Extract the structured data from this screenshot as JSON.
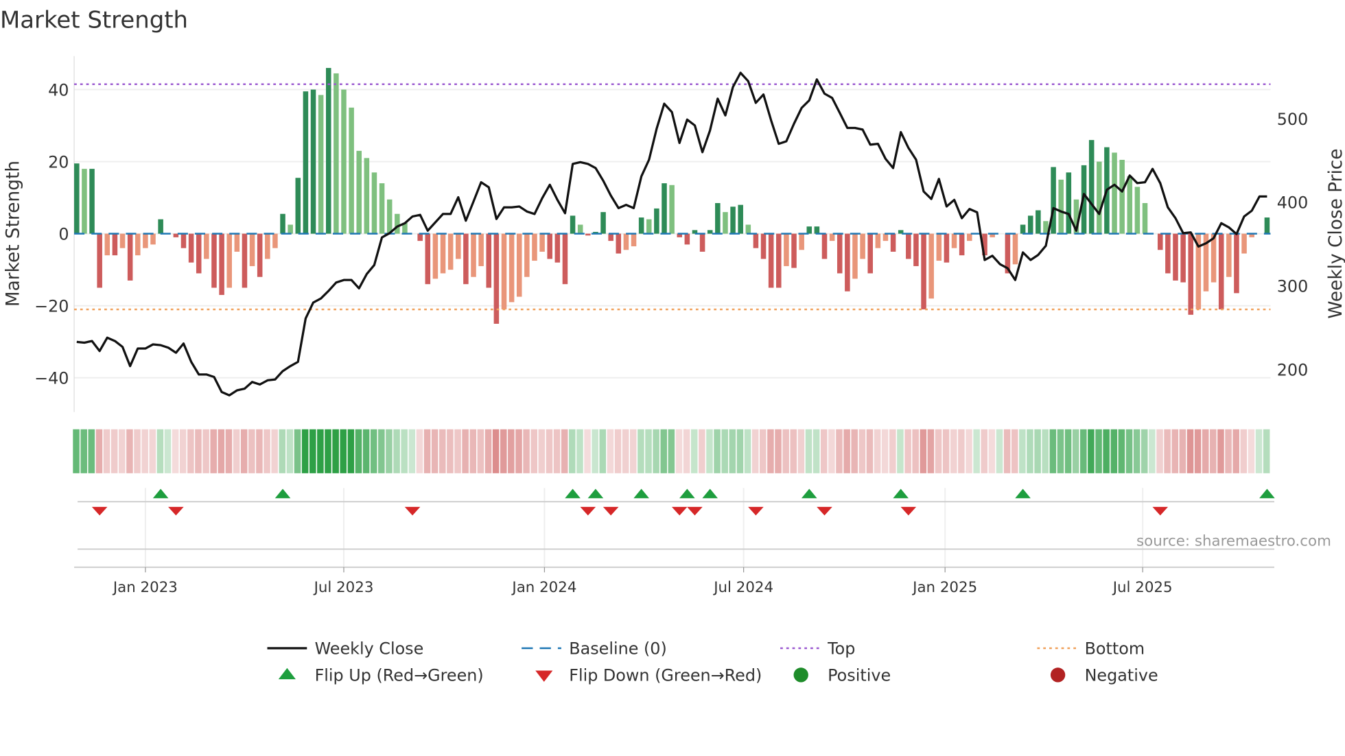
{
  "chart_data": {
    "type": "bar",
    "title": "Market Strength",
    "ylabel": "Market Strength",
    "y2label": "Weekly Close Price",
    "ylim": [
      -49.5,
      49.3
    ],
    "y2lim": [
      149,
      575
    ],
    "yticks": [
      {
        "v": 40,
        "label": "40"
      },
      {
        "v": 20,
        "label": "20"
      },
      {
        "v": 0,
        "label": "0"
      },
      {
        "v": -20,
        "label": "−20"
      },
      {
        "v": -40,
        "label": "−40"
      }
    ],
    "y2ticks": [
      {
        "v": 500,
        "label": "500"
      },
      {
        "v": 400,
        "label": "400"
      },
      {
        "v": 300,
        "label": "300"
      },
      {
        "v": 200,
        "label": "200"
      }
    ],
    "x_tick_labels": [
      {
        "week": 9,
        "label": "Jan 2023"
      },
      {
        "week": 35,
        "label": "Jul 2023"
      },
      {
        "week": 61.3,
        "label": "Jan 2024"
      },
      {
        "week": 87.4,
        "label": "Jul 2024"
      },
      {
        "week": 113.8,
        "label": "Jan 2025"
      },
      {
        "week": 139.7,
        "label": "Jul 2025"
      }
    ],
    "top_level": 41.5,
    "bottom_level": -21,
    "baseline": 0,
    "strength": [
      19.5,
      18,
      18,
      -15,
      -6,
      -6,
      -4,
      -13,
      -6,
      -4,
      -3,
      4,
      0,
      -1,
      -4,
      -8,
      -11,
      -7,
      -15,
      -17,
      -15,
      -5,
      -15,
      -9,
      -12,
      -7,
      -4,
      5.5,
      2.5,
      15.5,
      39.5,
      40,
      38.5,
      46,
      44.5,
      40,
      35,
      23,
      21,
      17,
      14,
      9.5,
      5.5,
      3,
      0,
      -2,
      -14,
      -12.5,
      -11,
      -10,
      -7,
      -14,
      -12,
      -9,
      -15,
      -25,
      -21,
      -19,
      -17.5,
      -12,
      -7.5,
      -5,
      -7,
      -8,
      -14,
      5,
      2.5,
      -0.5,
      0.5,
      6,
      -2,
      -5.5,
      -4.5,
      -3.5,
      4.5,
      4,
      7,
      14,
      13.5,
      -1,
      -3,
      1,
      -5,
      1,
      8.5,
      6,
      7.5,
      8,
      2.5,
      -4,
      -7,
      -15,
      -15,
      -9,
      -9.5,
      -4.5,
      2,
      2,
      -7,
      -2,
      -11,
      -16,
      -12.5,
      -7,
      -11,
      -4,
      -2,
      -5,
      1,
      -7,
      -9,
      -21,
      -18,
      -7.5,
      -8,
      -4,
      -6,
      -2,
      0,
      -6,
      -1,
      0,
      -11,
      -8.5,
      2.5,
      5,
      6.5,
      3.5,
      18.5,
      15,
      17,
      9.5,
      19,
      26,
      20,
      24,
      22.5,
      20.5,
      16,
      13,
      8.5,
      0,
      -4.5,
      -11,
      -13,
      -13.5,
      -22.5,
      -21,
      -16,
      -13.5,
      -21,
      -12,
      -16.5,
      -5.5,
      -1,
      0,
      4.5
    ],
    "weekly_close": [
      233,
      232,
      234,
      222,
      238,
      234,
      227,
      204,
      225,
      225,
      230,
      229,
      226,
      220,
      231,
      209,
      194,
      194,
      191,
      173,
      169,
      175,
      177,
      185,
      182,
      187,
      188,
      198,
      204,
      209,
      261,
      280,
      285,
      294,
      304,
      307,
      307,
      297,
      314,
      325,
      358,
      363,
      371,
      375,
      383,
      385,
      366,
      376,
      386,
      386,
      406,
      378,
      401,
      424,
      418,
      380,
      394,
      394,
      395,
      389,
      386,
      405,
      421,
      403,
      387,
      446,
      448,
      446,
      441,
      426,
      408,
      393,
      397,
      393,
      431,
      451,
      488,
      518,
      508,
      471,
      499,
      492,
      460,
      486,
      524,
      504,
      538,
      555,
      545,
      519,
      529,
      498,
      470,
      473,
      494,
      513,
      522,
      547,
      530,
      525,
      507,
      489,
      489,
      487,
      469,
      470,
      452,
      441,
      484,
      465,
      451,
      413,
      404,
      428,
      395,
      403,
      381,
      392,
      388,
      331,
      336,
      326,
      321,
      307,
      340,
      331,
      337,
      348,
      393,
      389,
      386,
      366,
      410,
      398,
      386,
      415,
      421,
      413,
      432,
      423,
      424,
      440,
      423,
      394,
      381,
      363,
      364,
      347,
      351,
      357,
      375,
      370,
      362,
      383,
      390,
      407,
      407
    ],
    "flip_up_weeks": [
      11,
      27,
      65,
      68,
      74,
      80,
      83,
      96,
      108,
      124,
      156
    ],
    "flip_down_weeks": [
      3,
      13,
      44,
      67,
      70,
      79,
      81,
      89,
      98,
      109,
      142
    ],
    "legend": [
      "Weekly Close",
      "Baseline (0)",
      "Top",
      "Bottom",
      "Flip Up (Red→Green)",
      "Flip Down (Green→Red)",
      "Positive",
      "Negative"
    ],
    "legend_placement": "bottom-center",
    "source": "source: sharemaestro.com",
    "colors": {
      "up_strong": "#2e8b57",
      "up_weak": "#7fc07f",
      "down_strong": "#cd5c5c",
      "down_weak": "#e9967a",
      "line": "#111111",
      "baseline": "#1f77b4",
      "top": "#9b59d0",
      "bottom": "#f0a05a",
      "flip_up": "#1e9e3e",
      "flip_down": "#d62728",
      "positive": "#1e8c2a",
      "negative": "#b22222"
    }
  }
}
